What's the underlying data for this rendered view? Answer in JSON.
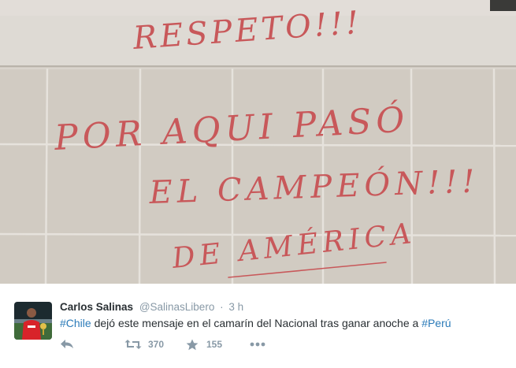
{
  "tweet": {
    "author_name": "Carlos Salinas",
    "handle": "@SalinasLibero",
    "separator": "·",
    "time": "3 h",
    "text_parts": {
      "hashtag1": "#Chile",
      "middle": " dejó este mensaje en el camarín del Nacional tras ganar anoche a ",
      "hashtag2": "#Perú"
    },
    "retweet_count": "370",
    "favorite_count": "155"
  },
  "photo": {
    "writing": {
      "line1": "RESPETO!!!",
      "line2": "POR AQUI PASÓ",
      "line3": "EL CAMPEÓN!!!",
      "line4": "DE AMÉRICA"
    }
  },
  "icons": [
    "reply-icon",
    "retweet-icon",
    "favorite-star-icon",
    "more-dots-icon"
  ],
  "colors": {
    "link": "#2b7bb9",
    "name": "#292f33",
    "meta": "#8899a6",
    "marker": "#c8585a"
  }
}
